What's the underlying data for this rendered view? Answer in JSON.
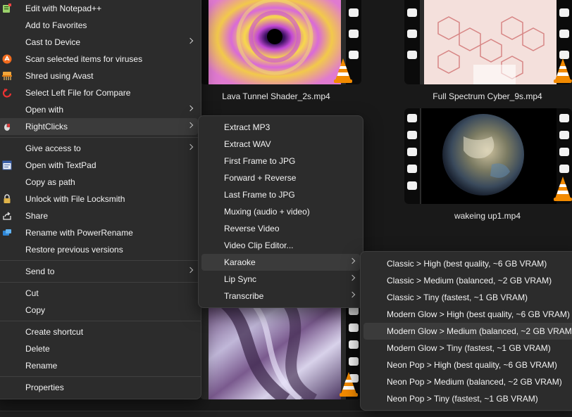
{
  "files": [
    {
      "name": "Lava Tunnel Shader_2s.mp4"
    },
    {
      "name": "Full Spectrum Cyber_9s.mp4"
    },
    {
      "name": "wakeing up1.mp4"
    }
  ],
  "context_menu": {
    "items": [
      {
        "label": "Edit with Notepad++",
        "icon": "notepad-plus-plus-icon"
      },
      {
        "label": "Add to Favorites"
      },
      {
        "label": "Cast to Device",
        "submenu": true
      },
      {
        "label": "Scan selected items for viruses",
        "icon": "avast-scan-icon"
      },
      {
        "label": "Shred using Avast",
        "icon": "avast-shred-icon"
      },
      {
        "label": "Select Left File for Compare",
        "icon": "compare-icon"
      },
      {
        "label": "Open with",
        "submenu": true
      },
      {
        "label": "RightClicks",
        "icon": "rightclicks-icon",
        "submenu": true,
        "highlighted": true
      },
      {
        "label": "Give access to",
        "submenu": true
      },
      {
        "label": "Open with TextPad",
        "icon": "textpad-icon"
      },
      {
        "label": "Copy as path"
      },
      {
        "label": "Unlock with File Locksmith",
        "icon": "lock-icon"
      },
      {
        "label": "Share",
        "icon": "share-icon"
      },
      {
        "label": "Rename with PowerRename",
        "icon": "powerrename-icon"
      },
      {
        "label": "Restore previous versions"
      },
      {
        "label": "Send to",
        "submenu": true
      },
      {
        "label": "Cut"
      },
      {
        "label": "Copy"
      },
      {
        "label": "Create shortcut"
      },
      {
        "label": "Delete"
      },
      {
        "label": "Rename"
      },
      {
        "label": "Properties"
      }
    ]
  },
  "rightclicks_submenu": {
    "items": [
      {
        "label": "Extract MP3"
      },
      {
        "label": "Extract WAV"
      },
      {
        "label": "First Frame to JPG"
      },
      {
        "label": "Forward + Reverse"
      },
      {
        "label": "Last Frame to JPG"
      },
      {
        "label": "Muxing (audio + video)"
      },
      {
        "label": "Reverse Video"
      },
      {
        "label": "Video Clip Editor..."
      },
      {
        "label": "Karaoke",
        "submenu": true,
        "highlighted": true
      },
      {
        "label": "Lip Sync",
        "submenu": true
      },
      {
        "label": "Transcribe",
        "submenu": true
      }
    ]
  },
  "karaoke_submenu": {
    "items": [
      {
        "label": "Classic > High (best quality, ~6 GB VRAM)"
      },
      {
        "label": "Classic > Medium (balanced, ~2 GB VRAM)"
      },
      {
        "label": "Classic > Tiny (fastest, ~1 GB VRAM)"
      },
      {
        "label": "Modern Glow > High (best quality, ~6 GB VRAM)"
      },
      {
        "label": "Modern Glow > Medium (balanced, ~2 GB VRAM)",
        "highlighted": true
      },
      {
        "label": "Modern Glow > Tiny (fastest, ~1 GB VRAM)"
      },
      {
        "label": "Neon Pop > High (best quality, ~6 GB VRAM)"
      },
      {
        "label": "Neon Pop > Medium (balanced, ~2 GB VRAM)"
      },
      {
        "label": "Neon Pop > Tiny (fastest, ~1 GB VRAM)"
      }
    ]
  },
  "colors": {
    "menu_bg": "#2c2c2c",
    "menu_highlight": "#3b3b3b",
    "text": "#f3f3f3",
    "avast_orange": "#f26b1d",
    "vlc_orange": "#f28a00"
  }
}
